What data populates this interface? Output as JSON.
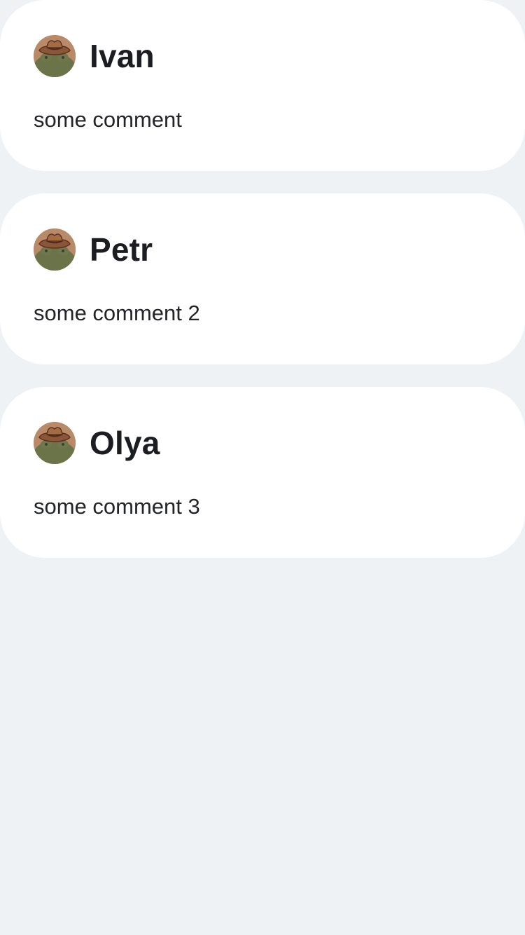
{
  "colors": {
    "page_background": "#eef2f5",
    "card_background": "#ffffff",
    "text_primary": "#1b1d21"
  },
  "avatar_icon": "cowboy-frog-avatar-icon",
  "comments": [
    {
      "author": "Ivan",
      "text": "some comment"
    },
    {
      "author": "Petr",
      "text": "some comment 2"
    },
    {
      "author": "Olya",
      "text": "some comment 3"
    }
  ]
}
